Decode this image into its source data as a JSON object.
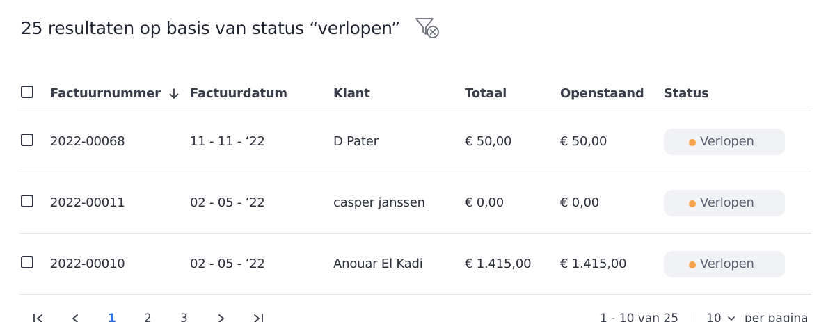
{
  "header": {
    "title": "25 resultaten op basis van status “verlopen”"
  },
  "table": {
    "columns": {
      "number": "Factuurnummer",
      "date": "Factuurdatum",
      "client": "Klant",
      "total": "Totaal",
      "open": "Openstaand",
      "status": "Status"
    },
    "rows": [
      {
        "number": "2022-00068",
        "date": "11 - 11 - ‘22",
        "client": "D Pater",
        "total": "€ 50,00",
        "open": "€ 50,00",
        "status": "Verlopen"
      },
      {
        "number": "2022-00011",
        "date": "02 - 05 - ‘22",
        "client": "casper janssen",
        "total": "€ 0,00",
        "open": "€ 0,00",
        "status": "Verlopen"
      },
      {
        "number": "2022-00010",
        "date": "02 - 05 - ‘22",
        "client": "Anouar El Kadi",
        "total": "€ 1.415,00",
        "open": "€ 1.415,00",
        "status": "Verlopen"
      }
    ]
  },
  "pagination": {
    "pages": [
      "1",
      "2",
      "3"
    ],
    "active_page": "1",
    "range": "1 - 10 van 25",
    "per_page": "10",
    "per_page_label": "per pagina"
  },
  "colors": {
    "status_dot": "#f5a24b",
    "active_page": "#2f6fe0"
  },
  "icons": {
    "filter_clear": "filter-clear-icon",
    "sort": "arrow-down-icon",
    "first": "first-page-icon",
    "prev": "chevron-left-icon",
    "next": "chevron-right-icon",
    "last": "last-page-icon"
  }
}
